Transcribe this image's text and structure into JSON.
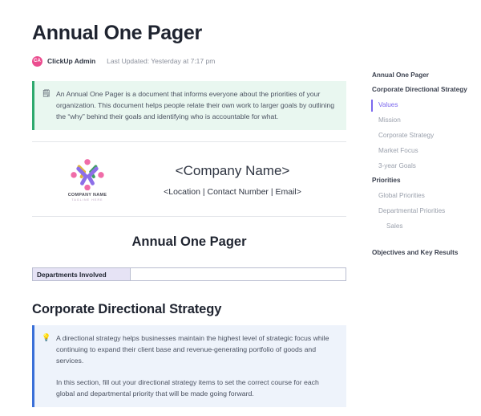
{
  "document": {
    "title": "Annual One Pager",
    "byline": {
      "avatar_initials": "CA",
      "avatar_color": "#eb4d8f",
      "author": "ClickUp Admin",
      "last_updated": "Last Updated: Yesterday at 7:17 pm"
    },
    "intro_callout": {
      "icon": "note-icon",
      "icon_glyph": "🗒",
      "accent_color": "#2fa96e",
      "background": "#e9f7f0",
      "text": "An Annual One Pager is a document that informs everyone about the priorities of your organization. This document helps people relate their own work to larger goals by outlining the “why” behind their goals and identifying who is accountable for what."
    },
    "company_header": {
      "logo_caption_name": "COMPANY NAME",
      "logo_caption_tagline": "TAGLINE HERE",
      "name": "<Company Name>",
      "details": "<Location | Contact Number | Email>"
    },
    "center_title": "Annual One Pager",
    "departments_table": {
      "rows": [
        {
          "label": "Departments Involved",
          "value": ""
        }
      ]
    },
    "strategy_section": {
      "heading": "Corporate Directional Strategy",
      "callout": {
        "icon": "lightbulb-icon",
        "icon_glyph": "💡",
        "accent_color": "#3a6fd8",
        "background": "#eef3fb",
        "paragraphs": [
          "A directional strategy helps businesses maintain the highest level of strategic focus while continuing to expand their client base and revenue-generating portfolio of goods and services.",
          "In this section, fill out your directional strategy items to set the correct course for each global and departmental priority that will be made going forward."
        ]
      }
    }
  },
  "outline": {
    "active_color": "#7b68ee",
    "items": [
      {
        "label": "Annual One Pager",
        "level": 1,
        "active": false
      },
      {
        "label": "Corporate Directional Strategy",
        "level": 1,
        "active": false
      },
      {
        "label": "Values",
        "level": 2,
        "active": true
      },
      {
        "label": "Mission",
        "level": 2,
        "active": false
      },
      {
        "label": "Corporate Strategy",
        "level": 2,
        "active": false
      },
      {
        "label": "Market Focus",
        "level": 2,
        "active": false
      },
      {
        "label": "3-year Goals",
        "level": 2,
        "active": false
      },
      {
        "label": "Priorities",
        "level": 1,
        "active": false
      },
      {
        "label": "Global Priorities",
        "level": 2,
        "active": false
      },
      {
        "label": "Departmental Priorities",
        "level": 2,
        "active": false
      },
      {
        "label": "Sales",
        "level": 3,
        "active": false
      },
      {
        "label": "",
        "level": 0,
        "active": false
      },
      {
        "label": "Objectives and Key Results",
        "level": 1,
        "active": false
      }
    ]
  }
}
